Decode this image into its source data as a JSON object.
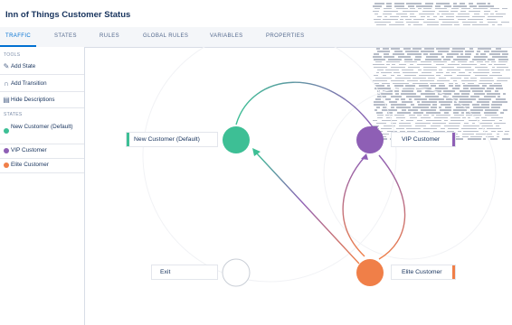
{
  "app": {
    "title": "Inn of Things Customer Status"
  },
  "tabs": [
    {
      "label": "TRAFFIC"
    },
    {
      "label": "STATES"
    },
    {
      "label": "RULES"
    },
    {
      "label": "GLOBAL RULES"
    },
    {
      "label": "VARIABLES"
    },
    {
      "label": "PROPERTIES"
    }
  ],
  "sidebar": {
    "tools_label": "TOOLS",
    "tools": [
      {
        "label": "Add State",
        "icon": "add-state-icon"
      },
      {
        "label": "Add Transition",
        "icon": "add-transition-icon"
      },
      {
        "label": "Hide Descriptions",
        "icon": "hide-descriptions-icon"
      }
    ],
    "states_label": "STATES",
    "states": [
      {
        "label": "New Customer (Default)",
        "color": "#3dbf95"
      },
      {
        "label": "VIP Customer",
        "color": "#8e5fb5"
      },
      {
        "label": "Elite Customer",
        "color": "#f07f48"
      }
    ]
  },
  "diagram": {
    "nodes": {
      "new_customer": {
        "label": "New Customer (Default)",
        "color": "#3dbf95"
      },
      "vip_customer": {
        "label": "VIP Customer",
        "color": "#8e5fb5"
      },
      "elite_customer": {
        "label": "Elite Customer",
        "color": "#f07f48"
      },
      "exit": {
        "label": "Exit",
        "color": "#ffffff"
      }
    },
    "edges": [
      {
        "from": "new_customer",
        "to": "vip_customer"
      },
      {
        "from": "vip_customer",
        "to": "elite_customer"
      },
      {
        "from": "elite_customer",
        "to": "vip_customer"
      },
      {
        "from": "elite_customer",
        "to": "new_customer"
      }
    ]
  },
  "colors": {
    "accent": "#0070d2",
    "new": "#3dbf95",
    "vip": "#8e5fb5",
    "elite": "#f07f48"
  }
}
